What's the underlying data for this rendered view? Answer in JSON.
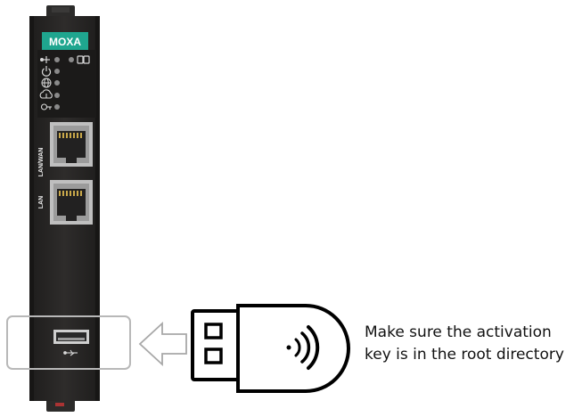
{
  "device": {
    "brand": "MOXA",
    "brand_color": "#1fa68f",
    "body_color": "#262524",
    "ports": [
      {
        "label": "LAN/WAN"
      },
      {
        "label": "LAN"
      }
    ],
    "indicators": [
      {
        "icon": "usb-icon"
      },
      {
        "icon": "power-icon"
      },
      {
        "icon": "globe-icon"
      },
      {
        "icon": "cloud-upload-icon"
      },
      {
        "icon": "key-icon"
      }
    ],
    "extra_indicator_icon": "link-icon",
    "usb_slot_icon": "usb-icon"
  },
  "usb_key": {
    "icon": "wireless-signal-icon"
  },
  "caption": {
    "line1": "Make sure the activation",
    "line2": "key is in the root directory"
  }
}
